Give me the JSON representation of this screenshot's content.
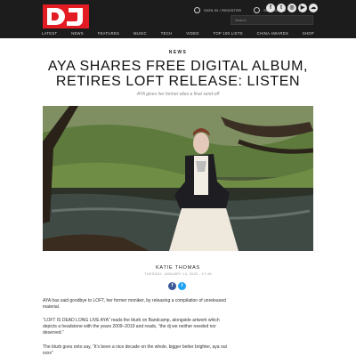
{
  "header": {
    "logo_text": "DJ",
    "account": {
      "sign_in": "SIGN IN / REGISTER",
      "subscribe": "SUBSCRIBE"
    },
    "social_icons": [
      "facebook-icon",
      "twitter-icon",
      "instagram-icon",
      "youtube-icon",
      "mixcloud-icon"
    ],
    "search": {
      "placeholder": "Search"
    },
    "nav": [
      "LATEST",
      "NEWS",
      "FEATURES",
      "MUSIC",
      "TECH",
      "VIDEO",
      "TOP 100 LISTS",
      "CHINA AWARDS",
      "SHOP"
    ]
  },
  "article": {
    "section": "NEWS",
    "headline": "AYA SHARES FREE DIGITAL ALBUM, RETIRES LOFT RELEASE: LISTEN",
    "subhead": "AYA gives her former alias a final send-off",
    "author": "KATIE THOMAS",
    "date": "TUESDAY, JANUARY 14, 2020 - 17:48",
    "share_icons": [
      "facebook-share-icon",
      "twitter-share-icon"
    ],
    "paragraphs": [
      "AYA has said goodbye to LOFT, her former moniker, by releasing a compilation of unreleased material.",
      "“LOFT IS DEAD LONG LIVE AYA” reads the blurb on Bandcamp, alongside artwork which depicts a headstone with the years 2009–2019 and reads, “the dj we neither needed nor deserved.”",
      "The blurb goes onto say, “It’s been a nice decade on the whole, bigger better brighter, aya out xxxx”"
    ]
  },
  "colors": {
    "header_bg": "#1c1c1c",
    "logo_red": "#e31b23",
    "facebook": "#3b5998",
    "twitter": "#1da1f2"
  }
}
